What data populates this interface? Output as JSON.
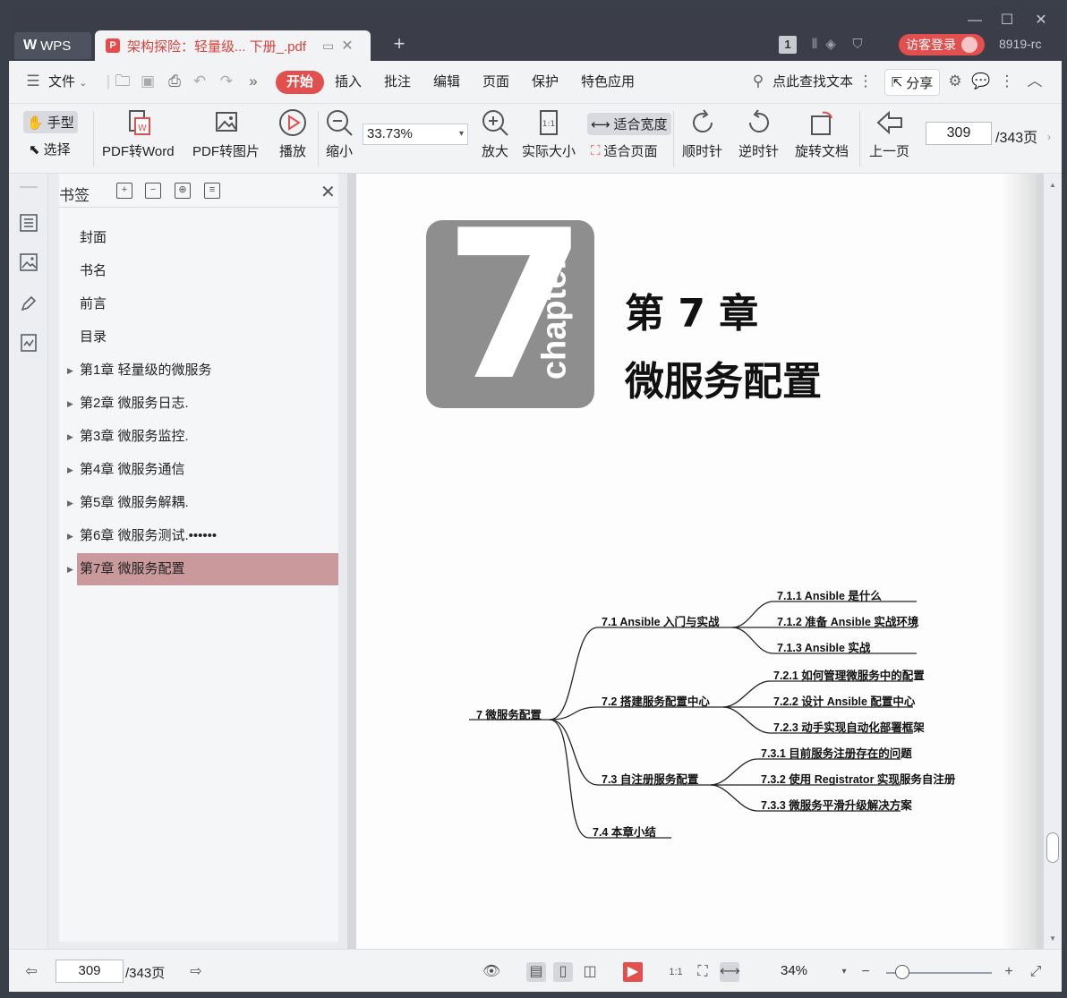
{
  "titlebar": {
    "app_tab": "WPS",
    "app_logo": "W",
    "doc_tab_title": "架构探险：轻量级... 下册_.pdf",
    "window_badge": "1",
    "login_label": "访客登录",
    "user_id": "8919-rc",
    "icons": [
      "minimize-icon",
      "maximize-icon",
      "close-icon",
      "plus-icon",
      "monitor-icon"
    ]
  },
  "menubar": {
    "file_label": "文件",
    "tabs": [
      "开始",
      "插入",
      "批注",
      "编辑",
      "页面",
      "保护",
      "特色应用"
    ],
    "search_label": "点此查找文本",
    "share_label": "分享"
  },
  "ribbon": {
    "hand_label": "手型",
    "select_label": "选择",
    "pdf_to_word": "PDF转Word",
    "pdf_to_image": "PDF转图片",
    "play": "播放",
    "zoom_out": "缩小",
    "zoom_value": "33.73%",
    "zoom_in": "放大",
    "actual_size": "实际大小",
    "fit_width": "适合宽度",
    "fit_page": "适合页面",
    "clockwise": "顺时针",
    "counter_clockwise": "逆时针",
    "rotate_doc": "旋转文档",
    "prev_page": "上一页",
    "page_current": "309",
    "page_total": "/343页"
  },
  "bookmarks": {
    "title": "书签",
    "items": [
      {
        "label": "封面",
        "expandable": false,
        "selected": false
      },
      {
        "label": "书名",
        "expandable": false,
        "selected": false
      },
      {
        "label": "前言",
        "expandable": false,
        "selected": false
      },
      {
        "label": "目录",
        "expandable": false,
        "selected": false
      },
      {
        "label": "第1章 轻量级的微服务",
        "expandable": true,
        "selected": false
      },
      {
        "label": "第2章 微服务日志.",
        "expandable": true,
        "selected": false
      },
      {
        "label": "第3章 微服务监控.",
        "expandable": true,
        "selected": false
      },
      {
        "label": "第4章 微服务通信",
        "expandable": true,
        "selected": false
      },
      {
        "label": "第5章 微服务解耦.",
        "expandable": true,
        "selected": false
      },
      {
        "label": "第6章 微服务测试.••••••",
        "expandable": true,
        "selected": false
      },
      {
        "label": "第7章 微服务配置",
        "expandable": true,
        "selected": true
      }
    ]
  },
  "page": {
    "chapter_number": "7",
    "chapter_word": "chapter",
    "title_line1": "第 7 章",
    "title_line2": "微服务配置",
    "mindmap": {
      "root": "7 微服务配置",
      "branches": [
        {
          "label": "7.1 Ansible 入门与实战",
          "children": [
            "7.1.1 Ansible 是什么",
            "7.1.2 准备 Ansible 实战环境",
            "7.1.3 Ansible 实战"
          ]
        },
        {
          "label": "7.2 搭建服务配置中心",
          "children": [
            "7.2.1 如何管理微服务中的配置",
            "7.2.2 设计 Ansible 配置中心",
            "7.2.3 动手实现自动化部署框架"
          ]
        },
        {
          "label": "7.3 自注册服务配置",
          "children": [
            "7.3.1 目前服务注册存在的问题",
            "7.3.2 使用 Registrator 实现服务自注册",
            "7.3.3 微服务平滑升级解决方案"
          ]
        },
        {
          "label": "7.4 本章小结",
          "children": []
        }
      ]
    }
  },
  "statusbar": {
    "page_current": "309",
    "page_total": "/343页",
    "zoom": "34%"
  },
  "colors": {
    "accent_red": "#e24f4f",
    "selected_bookmark": "#c9999c",
    "titlebar_bg": "#3b3d48",
    "chapter_badge": "#8e8e8e"
  }
}
